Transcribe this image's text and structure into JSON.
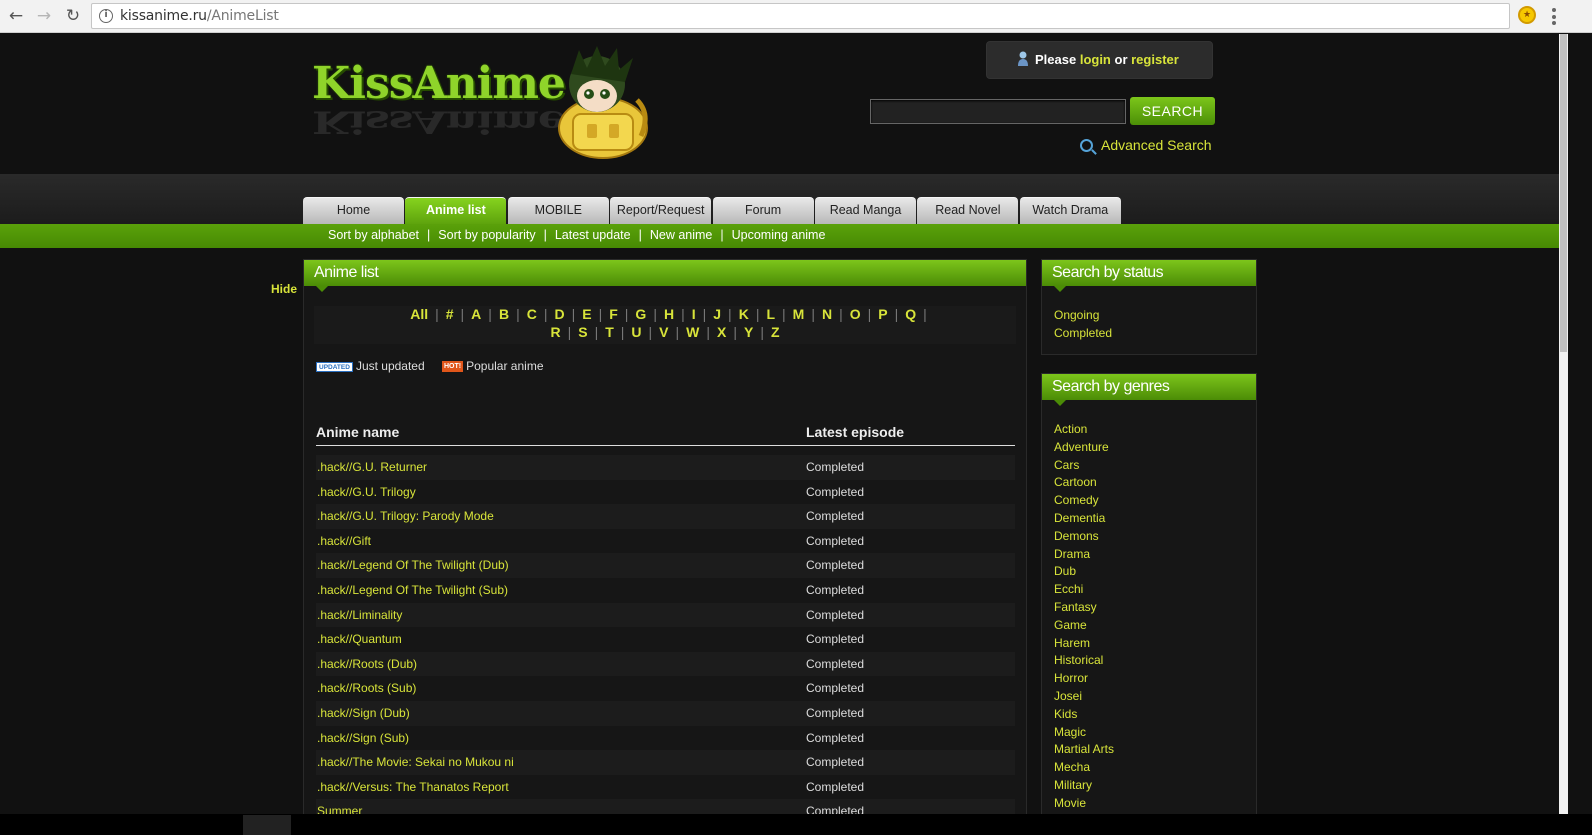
{
  "browser": {
    "url_domain": "kissanime.ru",
    "url_path": "/AnimeList",
    "back_icon": "←",
    "forward_icon": "→",
    "reload_icon": "↻",
    "info_icon": "i"
  },
  "header": {
    "logo_text": "KissAnime",
    "login": {
      "prefix": "Please",
      "login_label": "login",
      "middle": "or",
      "register_label": "register"
    },
    "search": {
      "input_value": "",
      "button_label": "SEARCH",
      "advanced_label": "Advanced Search"
    }
  },
  "nav": {
    "tabs": [
      "Home",
      "Anime list",
      "MOBILE",
      "Report/Request",
      "Forum",
      "Read Manga",
      "Read Novel",
      "Watch Drama"
    ],
    "active_tab": "Anime list",
    "subnav": [
      "Sort by alphabet",
      "Sort by popularity",
      "Latest update",
      "New anime",
      "Upcoming anime"
    ]
  },
  "sidebar_left": {
    "hide_label": "Hide"
  },
  "main": {
    "title": "Anime list",
    "alphabet_row1": [
      "All",
      "#",
      "A",
      "B",
      "C",
      "D",
      "E",
      "F",
      "G",
      "H",
      "I",
      "J",
      "K",
      "L",
      "M",
      "N",
      "O",
      "P",
      "Q"
    ],
    "alphabet_row2": [
      "R",
      "S",
      "T",
      "U",
      "V",
      "W",
      "X",
      "Y",
      "Z"
    ],
    "legend": {
      "updated_badge": "UPDATED",
      "updated_label": "Just updated",
      "hot_badge": "HOT!",
      "hot_label": "Popular anime"
    },
    "table": {
      "col_name": "Anime name",
      "col_episode": "Latest episode",
      "rows": [
        {
          "name": ".hack//G.U. Returner",
          "episode": "Completed"
        },
        {
          "name": ".hack//G.U. Trilogy",
          "episode": "Completed"
        },
        {
          "name": ".hack//G.U. Trilogy: Parody Mode",
          "episode": "Completed"
        },
        {
          "name": ".hack//Gift",
          "episode": "Completed"
        },
        {
          "name": ".hack//Legend Of The Twilight (Dub)",
          "episode": "Completed"
        },
        {
          "name": ".hack//Legend Of The Twilight (Sub)",
          "episode": "Completed"
        },
        {
          "name": ".hack//Liminality",
          "episode": "Completed"
        },
        {
          "name": ".hack//Quantum",
          "episode": "Completed"
        },
        {
          "name": ".hack//Roots (Dub)",
          "episode": "Completed"
        },
        {
          "name": ".hack//Roots (Sub)",
          "episode": "Completed"
        },
        {
          "name": ".hack//Sign (Dub)",
          "episode": "Completed"
        },
        {
          "name": ".hack//Sign (Sub)",
          "episode": "Completed"
        },
        {
          "name": ".hack//The Movie: Sekai no Mukou ni",
          "episode": "Completed"
        },
        {
          "name": ".hack//Versus: The Thanatos Report",
          "episode": "Completed"
        },
        {
          "name": " Summer",
          "episode": "Completed"
        }
      ]
    }
  },
  "status_panel": {
    "title": "Search by status",
    "items": [
      "Ongoing",
      "Completed"
    ]
  },
  "genre_panel": {
    "title": "Search by genres",
    "items": [
      "Action",
      "Adventure",
      "Cars",
      "Cartoon",
      "Comedy",
      "Dementia",
      "Demons",
      "Drama",
      "Dub",
      "Ecchi",
      "Fantasy",
      "Game",
      "Harem",
      "Historical",
      "Horror",
      "Josei",
      "Kids",
      "Magic",
      "Martial Arts",
      "Mecha",
      "Military",
      "Movie"
    ]
  },
  "colors": {
    "accent_green": "#5ea30d",
    "link_yellow": "#d8e43a",
    "background": "#111111"
  }
}
